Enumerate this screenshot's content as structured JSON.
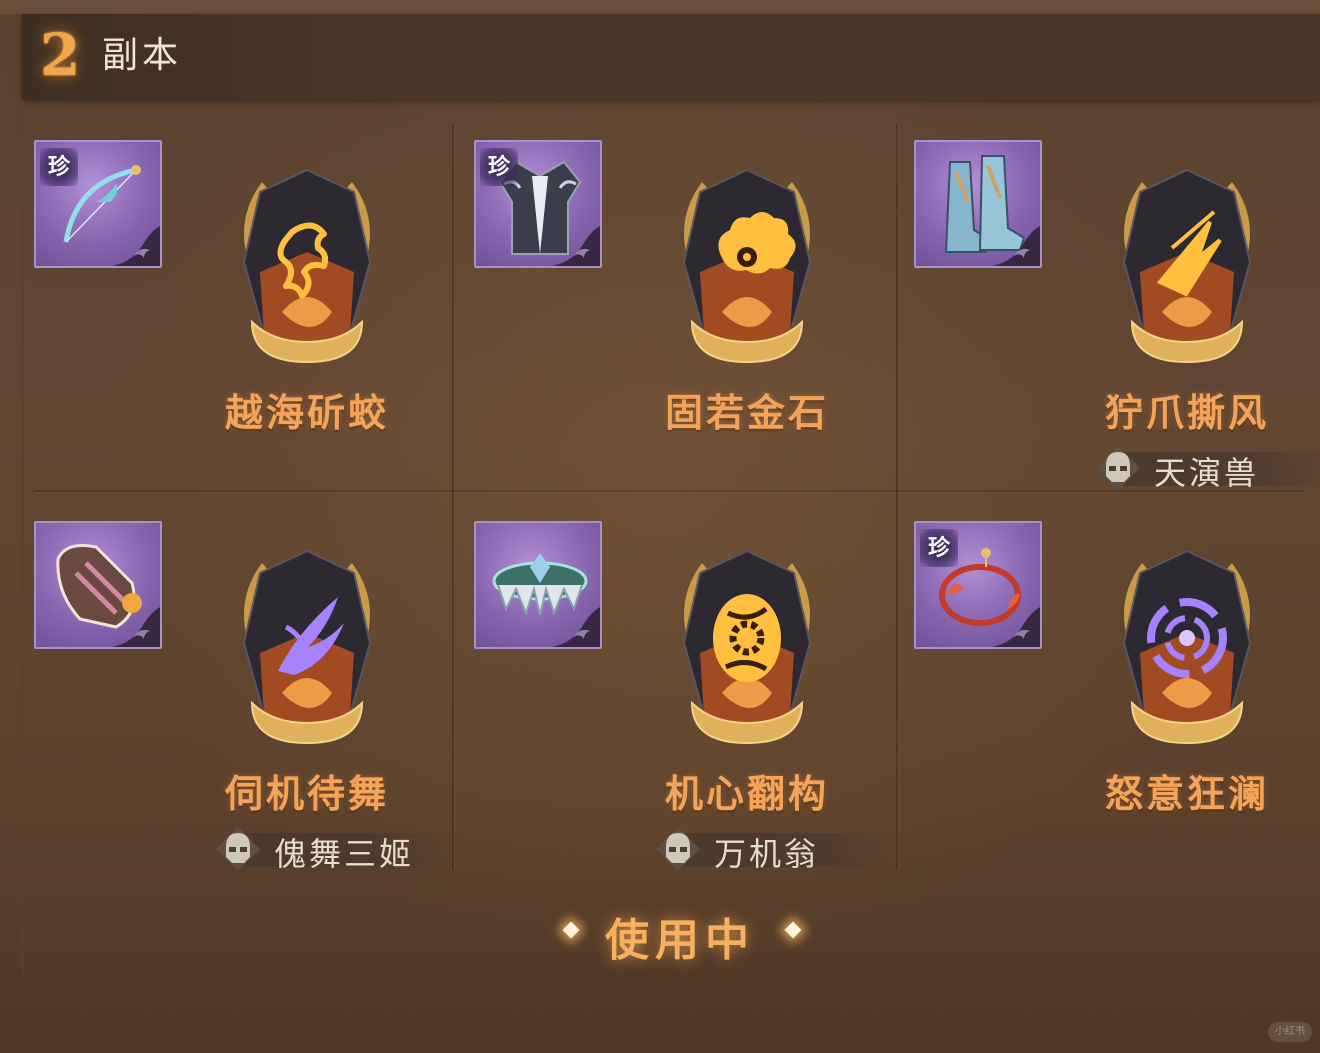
{
  "header": {
    "number": "2",
    "title": "副本"
  },
  "skills": [
    {
      "name": "越海斫蛟",
      "item": "bow",
      "rare": true,
      "rare_label": "珍",
      "gem_icon": "dragon",
      "gem_color": "#ffc040",
      "source": null
    },
    {
      "name": "固若金石",
      "item": "robe",
      "rare": true,
      "rare_label": "珍",
      "gem_icon": "cloud-swirl",
      "gem_color": "#ffc040",
      "source": null
    },
    {
      "name": "狞爪撕风",
      "item": "boots",
      "rare": false,
      "gem_icon": "claw",
      "gem_color": "#ffc040",
      "source": "天演兽"
    },
    {
      "name": "伺机待舞",
      "item": "bracer",
      "rare": false,
      "gem_icon": "blade",
      "gem_color": "#a782ff",
      "source": "傀舞三姬"
    },
    {
      "name": "机心翻构",
      "item": "belt",
      "rare": false,
      "gem_icon": "gear",
      "gem_color": "#ffc040",
      "source": "万机翁"
    },
    {
      "name": "怒意狂澜",
      "item": "bracelet",
      "rare": true,
      "rare_label": "珍",
      "gem_icon": "vortex",
      "gem_color": "#a782ff",
      "source": null
    }
  ],
  "status": {
    "label": "使用中"
  },
  "watermark": "小红书",
  "colors": {
    "accent": "#f3a45a",
    "item_frame": "#a793c7",
    "background": "#5c422d"
  }
}
